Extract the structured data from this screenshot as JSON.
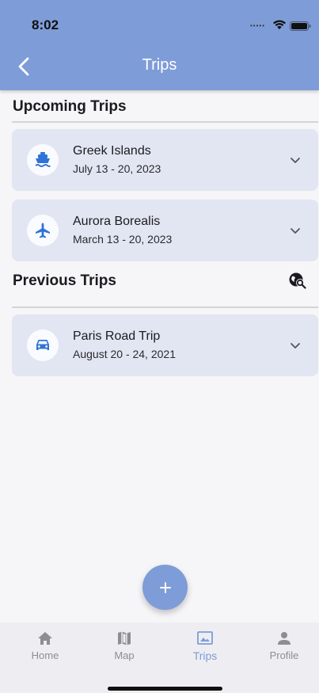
{
  "status_bar": {
    "time": "8:02"
  },
  "header": {
    "title": "Trips"
  },
  "upcoming": {
    "heading": "Upcoming Trips",
    "trips": [
      {
        "name": "Greek Islands",
        "dates": "July 13 - 20, 2023",
        "icon": "ship-icon"
      },
      {
        "name": "Aurora Borealis",
        "dates": "March 13 - 20, 2023",
        "icon": "airplane-icon"
      }
    ]
  },
  "previous": {
    "heading": "Previous Trips",
    "search_icon": "travel-explore-icon",
    "trips": [
      {
        "name": "Paris Road Trip",
        "dates": "August 20 - 24, 2021",
        "icon": "car-icon"
      }
    ]
  },
  "fab": {
    "label": "+"
  },
  "bottom_nav": {
    "items": [
      {
        "label": "Home",
        "icon": "home-icon",
        "active": false
      },
      {
        "label": "Map",
        "icon": "map-icon",
        "active": false
      },
      {
        "label": "Trips",
        "icon": "photo-icon",
        "active": true
      },
      {
        "label": "Profile",
        "icon": "person-icon",
        "active": false
      }
    ]
  },
  "colors": {
    "primary": "#7e9cd8",
    "card": "#e2e6f2",
    "icon_blue": "#2f73d8"
  }
}
